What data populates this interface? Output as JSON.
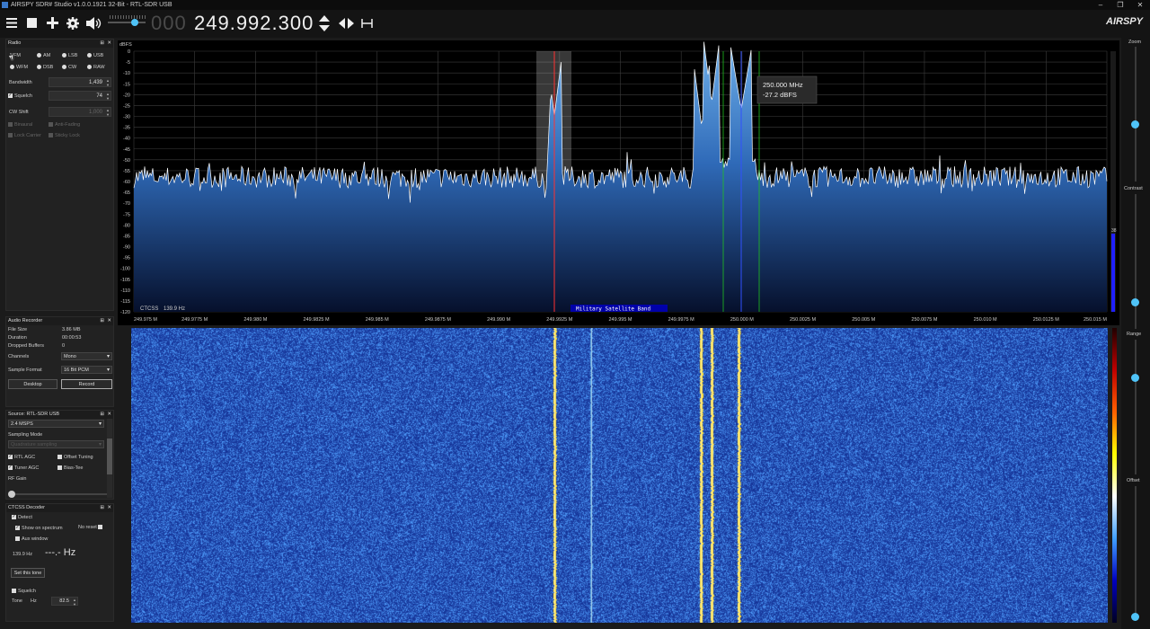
{
  "title": "AIRSPY SDR# Studio v1.0.0.1921 32-Bit - RTL-SDR USB",
  "window_buttons": [
    "‒",
    "❐",
    "✕"
  ],
  "toolbar": {
    "freq_leading": "000",
    "frequency": "249.992.300",
    "logo": "AIRSPY"
  },
  "radio": {
    "header": "Radio",
    "modes": [
      "NFM",
      "AM",
      "LSB",
      "USB",
      "WFM",
      "DSB",
      "CW",
      "RAW"
    ],
    "selected_mode": "NFM",
    "bandwidth_label": "Bandwidth",
    "bandwidth": "1,439",
    "squelch_label": "Squelch",
    "squelch": "74",
    "cw_shift_label": "CW Shift",
    "cw_shift": "1,000",
    "binaural": "Binaural",
    "anti_fading": "Anti-Fading",
    "lock_carrier": "Lock Carrier",
    "sticky_lock": "Sticky Lock"
  },
  "recorder": {
    "header": "Audio Recorder",
    "file_size_label": "File Size",
    "file_size": "3.86 MB",
    "duration_label": "Duration",
    "duration": "00:00:53",
    "dropped_label": "Dropped Buffers",
    "dropped": "0",
    "channels_label": "Channels",
    "channels": "Mono",
    "format_label": "Sample Format",
    "format": "16 Bit PCM",
    "desktop_btn": "Desktop",
    "record_btn": "Record"
  },
  "source": {
    "header": "Source: RTL-SDR USB",
    "rate": "2.4 MSPS",
    "sampling_label": "Sampling Mode",
    "sampling": "Quadrature sampling",
    "rtl_agc": "RTL AGC",
    "offset_tuning": "Offset Tuning",
    "tuner_agc": "Tuner AGC",
    "bias_tee": "Bias-Tee",
    "rf_gain": "RF Gain"
  },
  "ctcss": {
    "header": "CTCSS Decoder",
    "detect": "Detect",
    "show_spectrum": "Show on spectrum",
    "no_reset": "No reset",
    "aux_window": "Aux window",
    "tone_hz": "139.9 Hz",
    "readout": "---.- Hz",
    "set_tone_btn": "Set this tone",
    "squelch": "Squelch",
    "tone_label": "Tone",
    "hz_label": "Hz",
    "tone_value": "82.5"
  },
  "right": {
    "zoom": "Zoom",
    "contrast": "Contrast",
    "range": "Range",
    "offset": "Offset",
    "level": "38"
  },
  "spectrum": {
    "y_unit": "dBFS",
    "y_ticks": [
      "0",
      "-5",
      "-10",
      "-15",
      "-20",
      "-25",
      "-30",
      "-35",
      "-40",
      "-45",
      "-50",
      "-55",
      "-60",
      "-65",
      "-70",
      "-75",
      "-80",
      "-85",
      "-90",
      "-95",
      "-100",
      "-105",
      "-110",
      "-115",
      "-120"
    ],
    "x_ticks": [
      "249.975 M",
      "249.9775 M",
      "249.980 M",
      "249.9825 M",
      "249.985 M",
      "249.9875 M",
      "249.990 M",
      "249.9925 M",
      "249.995 M",
      "249.9975 M",
      "250.000 M",
      "250.0025 M",
      "250.005 M",
      "250.0075 M",
      "250.010 M",
      "250.0125 M",
      "250.015 M"
    ],
    "tooltip_freq": "250.000 MHz",
    "tooltip_level": "-27.2 dBFS",
    "ctcss_label": "CTCSS",
    "ctcss_value": "139.9 Hz",
    "band_label": "Military Satellite Band",
    "colors": {
      "fill_top": "#5aa0e0",
      "fill_bottom": "#0a1a40",
      "trace": "#ffffff",
      "tuned": "#ff3030",
      "marker": "#3050ff",
      "green": "#20c020"
    }
  }
}
